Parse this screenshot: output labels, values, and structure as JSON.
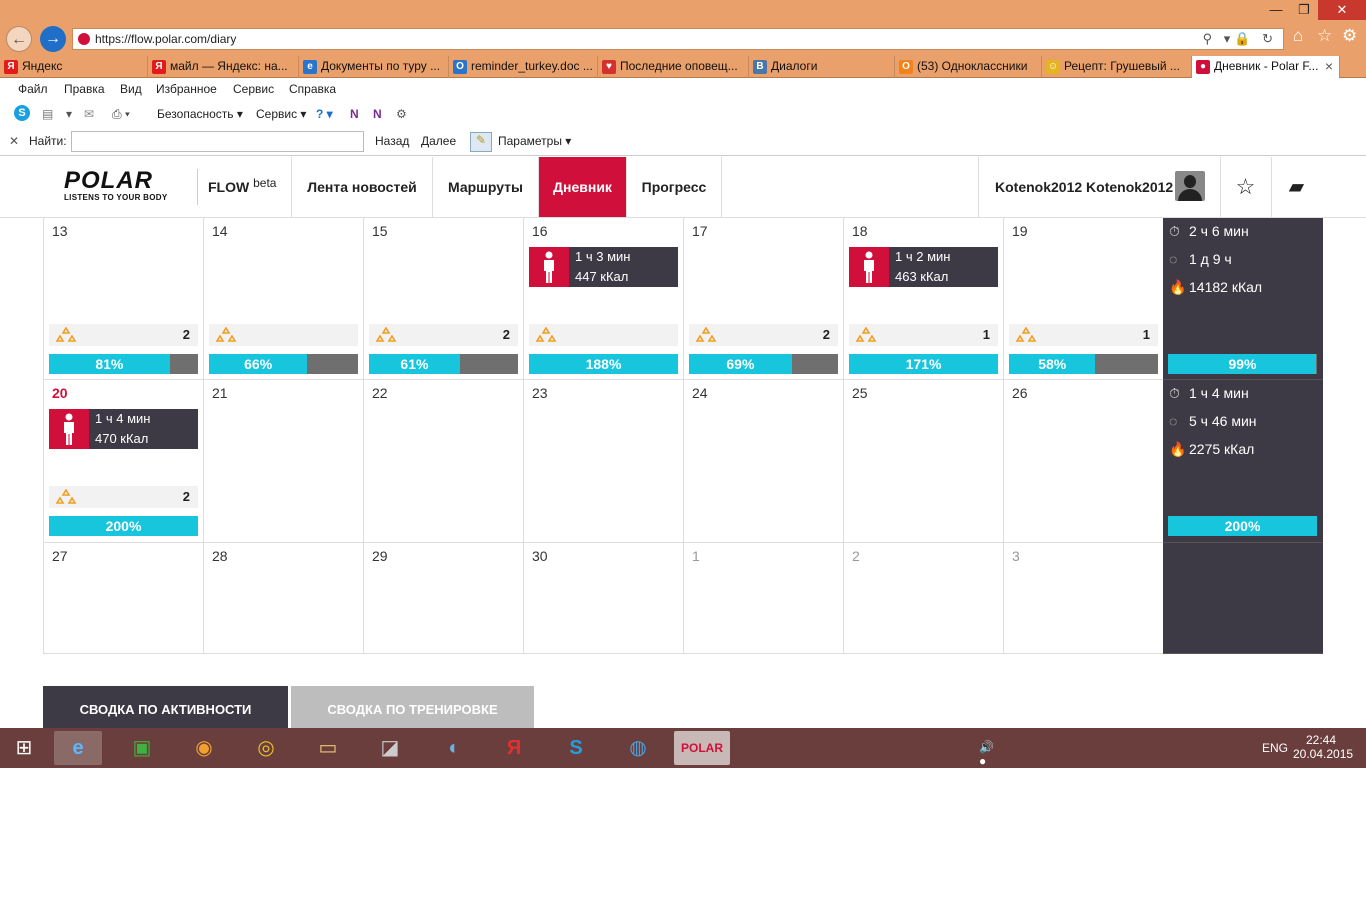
{
  "browser": {
    "url": "https://flow.polar.com/diary",
    "tabs": [
      {
        "label": "Яндекс",
        "color": "#e21c1c",
        "glyph": "Я"
      },
      {
        "label": "майл — Яндекс: на...",
        "color": "#e21c1c",
        "glyph": "Я"
      },
      {
        "label": "Документы по туру ...",
        "color": "#2a74c9",
        "glyph": "e"
      },
      {
        "label": "reminder_turkey.doc ...",
        "color": "#2a74c9",
        "glyph": "O"
      },
      {
        "label": "Последние оповещ...",
        "color": "#d3322c",
        "glyph": "♥"
      },
      {
        "label": "Диалоги",
        "color": "#4a76a8",
        "glyph": "В"
      },
      {
        "label": "(53) Одноклассники",
        "color": "#f2821c",
        "glyph": "О"
      },
      {
        "label": "Рецепт: Грушевый ...",
        "color": "#e6b422",
        "glyph": "☺"
      },
      {
        "label": "Дневник - Polar F...",
        "color": "#d0103a",
        "glyph": "●"
      }
    ],
    "tab_close": "×",
    "menu": [
      "Файл",
      "Правка",
      "Вид",
      "Избранное",
      "Сервис",
      "Справка"
    ],
    "commands": {
      "security": "Безопасность ▾",
      "service": "Сервис ▾"
    },
    "find": {
      "label": "Найти:",
      "back": "Назад",
      "next": "Далее",
      "options": "Параметры ▾"
    }
  },
  "polar": {
    "logo": "POLAR",
    "tagline": "LISTENS TO YOUR BODY",
    "flow": "FLOW",
    "beta": "beta",
    "nav": [
      "Лента новостей",
      "Маршруты",
      "Дневник",
      "Прогресс"
    ],
    "active_nav": "Дневник",
    "user": "Kotenok2012 Kotenok2012"
  },
  "calendar": {
    "week1": {
      "days": [
        {
          "num": "13",
          "goal": "2",
          "pct": 81
        },
        {
          "num": "14",
          "goal": "",
          "pct": 66
        },
        {
          "num": "15",
          "goal": "2",
          "pct": 61
        },
        {
          "num": "16",
          "goal": "",
          "pct": 188,
          "ev": {
            "dur": "1 ч 3 мин",
            "kcal": "447 кКал"
          }
        },
        {
          "num": "17",
          "goal": "2",
          "pct": 69
        },
        {
          "num": "18",
          "goal": "1",
          "pct": 171,
          "ev": {
            "dur": "1 ч 2 мин",
            "kcal": "463 кКал"
          }
        },
        {
          "num": "19",
          "goal": "1",
          "pct": 58
        }
      ],
      "summary": {
        "time": "2 ч 6 мин",
        "active": "1 д 9 ч",
        "kcal": "14182 кКал",
        "pct": 99
      }
    },
    "week2": {
      "days": [
        {
          "num": "20",
          "goal": "2",
          "pct": 200,
          "ev": {
            "dur": "1 ч 4 мин",
            "kcal": "470 кКал"
          },
          "today": true
        },
        {
          "num": "21"
        },
        {
          "num": "22"
        },
        {
          "num": "23"
        },
        {
          "num": "24"
        },
        {
          "num": "25"
        },
        {
          "num": "26"
        }
      ],
      "summary": {
        "time": "1 ч 4 мин",
        "active": "5 ч 46 мин",
        "kcal": "2275 кКал",
        "pct": 200
      }
    },
    "week3": {
      "days": [
        {
          "num": "27"
        },
        {
          "num": "28"
        },
        {
          "num": "29"
        },
        {
          "num": "30"
        },
        {
          "num": "1",
          "muted": true
        },
        {
          "num": "2",
          "muted": true
        },
        {
          "num": "3",
          "muted": true
        }
      ]
    }
  },
  "bottom_tabs": [
    "СВОДКА ПО АКТИВНОСТИ",
    "СВОДКА ПО ТРЕНИРОВКЕ"
  ],
  "taskbar": {
    "lang": "ENG",
    "time": "22:44",
    "date": "20.04.2015"
  },
  "colors": {
    "accent": "#d0103a",
    "bar_fill": "#17c5dc",
    "bar_bg": "#6f6f6f",
    "dark": "#3d3a45"
  }
}
